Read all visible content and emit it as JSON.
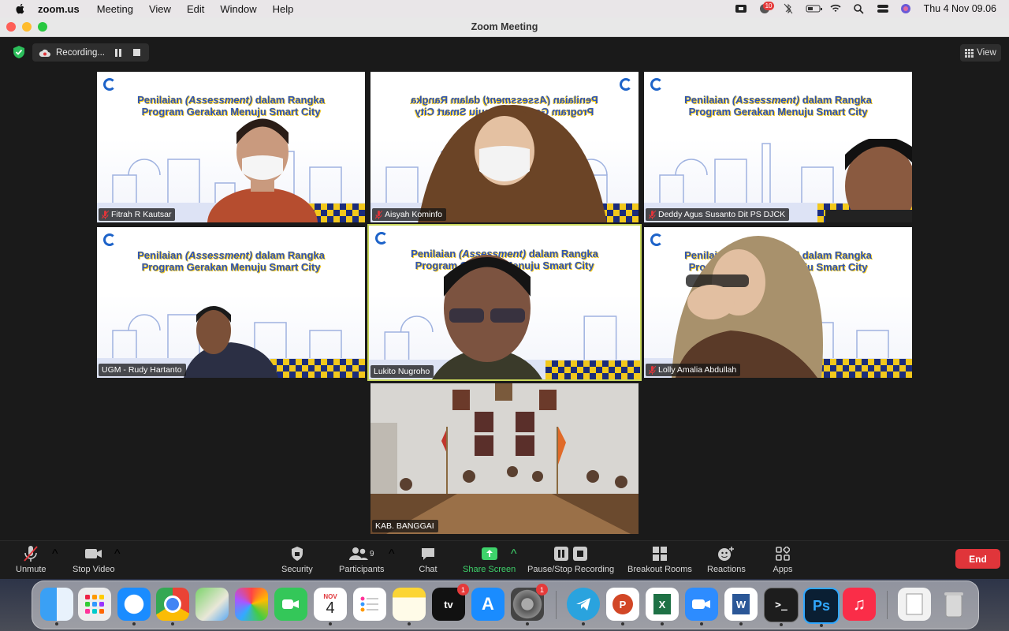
{
  "menubar": {
    "app_name": "zoom.us",
    "items": [
      "Meeting",
      "View",
      "Edit",
      "Window",
      "Help"
    ],
    "notification_count": "10",
    "clock": "Thu 4 Nov  09.06"
  },
  "window": {
    "title": "Zoom Meeting"
  },
  "topbar": {
    "recording_label": "Recording...",
    "view_label": "View"
  },
  "banner": {
    "line1_pre": "Penilaian ",
    "line1_em": "(Assessment)",
    "line1_post": " dalam Rangka",
    "line2": "Program Gerakan Menuju Smart City"
  },
  "participants": [
    {
      "name": "Fitrah R Kautsar",
      "muted": true
    },
    {
      "name": "Aisyah Kominfo",
      "muted": true
    },
    {
      "name": "Deddy Agus Susanto Dit PS DJCK",
      "muted": true
    },
    {
      "name": "UGM - Rudy Hartanto",
      "muted": false
    },
    {
      "name": "Lukito Nugroho",
      "muted": false,
      "active_speaker": true
    },
    {
      "name": "Lolly Amalia Abdullah",
      "muted": true
    },
    {
      "name": "KAB. BANGGAI",
      "muted": false
    }
  ],
  "toolbar": {
    "unmute": "Unmute",
    "stop_video": "Stop Video",
    "security": "Security",
    "participants": "Participants",
    "participants_count": "9",
    "chat": "Chat",
    "share_screen": "Share Screen",
    "recording": "Pause/Stop Recording",
    "breakout": "Breakout Rooms",
    "reactions": "Reactions",
    "apps": "Apps",
    "end": "End"
  },
  "dock": {
    "calendar_month": "NOV",
    "calendar_day": "4",
    "tv_badge": "1",
    "settings_badge": "1"
  },
  "colors": {
    "accent_green": "#3ed36b",
    "end_red": "#e0353a",
    "active_outline": "#c8d65a",
    "banner_blue": "#2e54b8",
    "banner_yellow": "#f2c81c"
  }
}
